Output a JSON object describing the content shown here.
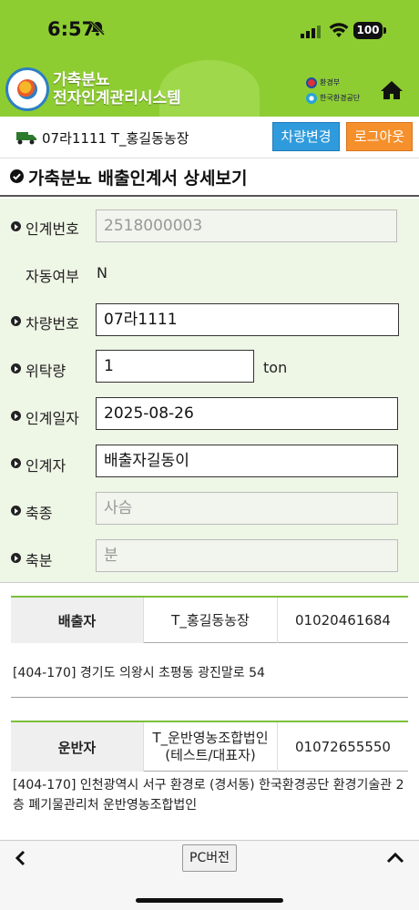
{
  "status": {
    "time": "6:57",
    "battery": "100"
  },
  "header": {
    "brand_line1": "가축분뇨",
    "brand_line2": "전자인계관리시스템",
    "org1": "환경부",
    "org2": "한국환경공단",
    "accent": "#8ecd32"
  },
  "vehicle": {
    "text": "07라1111  T_홍길동농장",
    "change_label": "차량변경",
    "logout_label": "로그아웃"
  },
  "page": {
    "title": "가축분뇨 배출인계서 상세보기"
  },
  "form": {
    "handover_no": {
      "label": "인계번호",
      "value": "2518000003"
    },
    "auto": {
      "label": "자동여부",
      "value": "N"
    },
    "vehicle_no": {
      "label": "차량번호",
      "value": "07라1111"
    },
    "amount": {
      "label": "위탁량",
      "value": "1",
      "unit": "ton"
    },
    "date": {
      "label": "인계일자",
      "value": "2025-08-26"
    },
    "handler": {
      "label": "인계자",
      "value": "배출자길동이"
    },
    "species": {
      "label": "축종",
      "placeholder": "사슴"
    },
    "manure": {
      "label": "축분",
      "placeholder": "분"
    }
  },
  "emitter": {
    "head": "배출자",
    "name": "T_홍길동농장",
    "phone": "01020461684",
    "address": "[404-170] 경기도 의왕시 초평동 광진말로 54"
  },
  "carrier": {
    "head": "운반자",
    "name": "T_운반영농조합법인(테스트/대표자)",
    "phone": "01072655550",
    "address": "[404-170] 인천광역시 서구 환경로 (경서동) 한국환경공단 환경기술관 2층 폐기물관리처 운반영농조합법인"
  },
  "bottom": {
    "pc_label": "PC버전"
  }
}
